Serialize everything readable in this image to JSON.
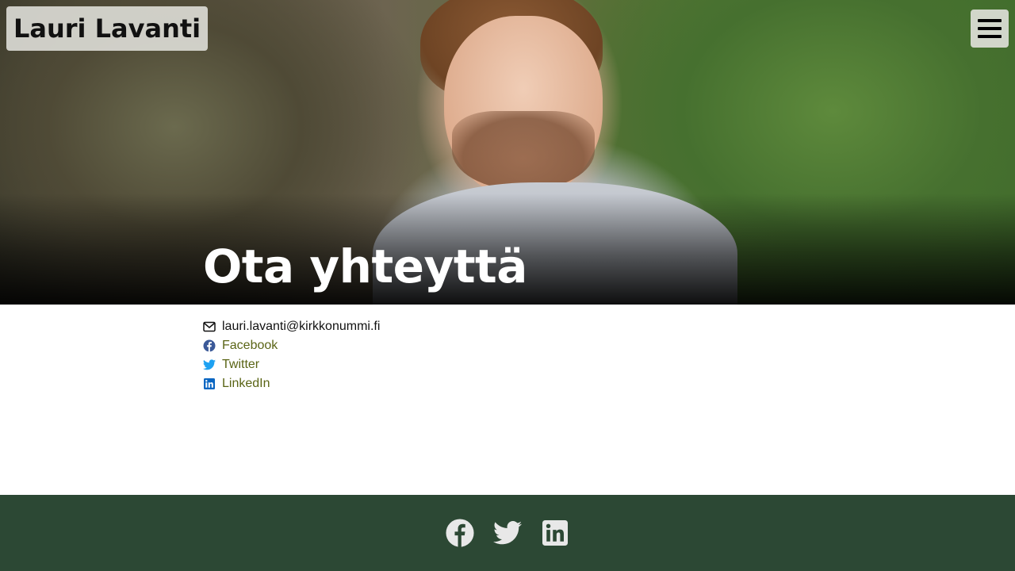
{
  "header": {
    "brand": "Lauri Lavanti",
    "menu_icon": "hamburger-menu-icon"
  },
  "hero": {
    "title": "Ota yhteyttä"
  },
  "contacts": [
    {
      "icon": "envelope-icon",
      "label": "lauri.lavanti@kirkkonummi.fi"
    },
    {
      "icon": "facebook-icon",
      "label": "Facebook",
      "color": "#3b5998"
    },
    {
      "icon": "twitter-icon",
      "label": "Twitter",
      "color": "#1da1f2"
    },
    {
      "icon": "linkedin-icon",
      "label": "LinkedIn",
      "color": "#0a66c2"
    }
  ],
  "footer": {
    "icons": [
      "facebook-icon",
      "twitter-icon",
      "linkedin-icon"
    ],
    "background": "#2c4834",
    "icon_color": "#e8e8e8"
  },
  "colors": {
    "link": "#5a6415",
    "hero_title": "#ffffff"
  }
}
